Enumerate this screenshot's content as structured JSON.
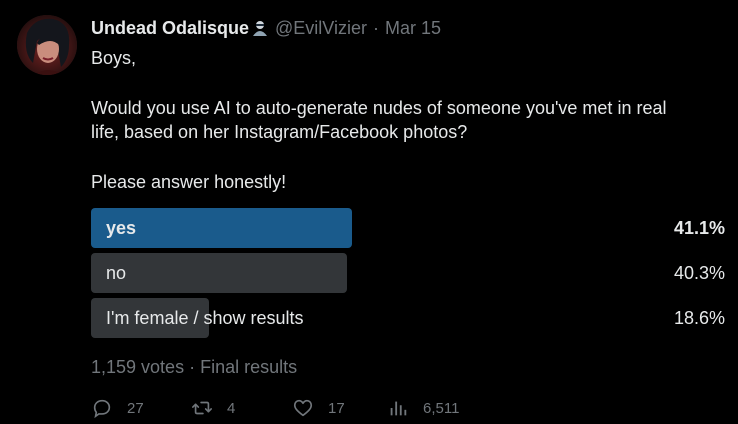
{
  "tweet": {
    "author": {
      "display_name": "Undead Odalisque",
      "handle": "@EvilVizier",
      "separator": "·",
      "date": "Mar 15"
    },
    "body": {
      "line1": "Boys,",
      "line2": "Would you use AI to auto-generate nudes of someone you've met in real",
      "line3": "life, based on her Instagram/Facebook photos?",
      "line4": "Please answer honestly!"
    },
    "poll": {
      "options": [
        {
          "label": "yes",
          "percent_text": "41.1%",
          "percent": 41.1,
          "winner": true
        },
        {
          "label": "no",
          "percent_text": "40.3%",
          "percent": 40.3,
          "winner": false
        },
        {
          "label": "I'm female / show results",
          "percent_text": "18.6%",
          "percent": 18.6,
          "winner": false
        }
      ],
      "votes": "1,159 votes",
      "separator": "·",
      "status": "Final results"
    },
    "actions": {
      "replies": "27",
      "retweets": "4",
      "likes": "17",
      "views": "6,511"
    },
    "colors": {
      "background": "#000000",
      "text": "#e7e9ea",
      "muted": "#71767b",
      "winner_bar": "#1a5b8c",
      "bar": "#333639"
    },
    "icons": [
      "reply-icon",
      "retweet-icon",
      "like-icon",
      "views-icon",
      "verified-badge-icon"
    ]
  }
}
